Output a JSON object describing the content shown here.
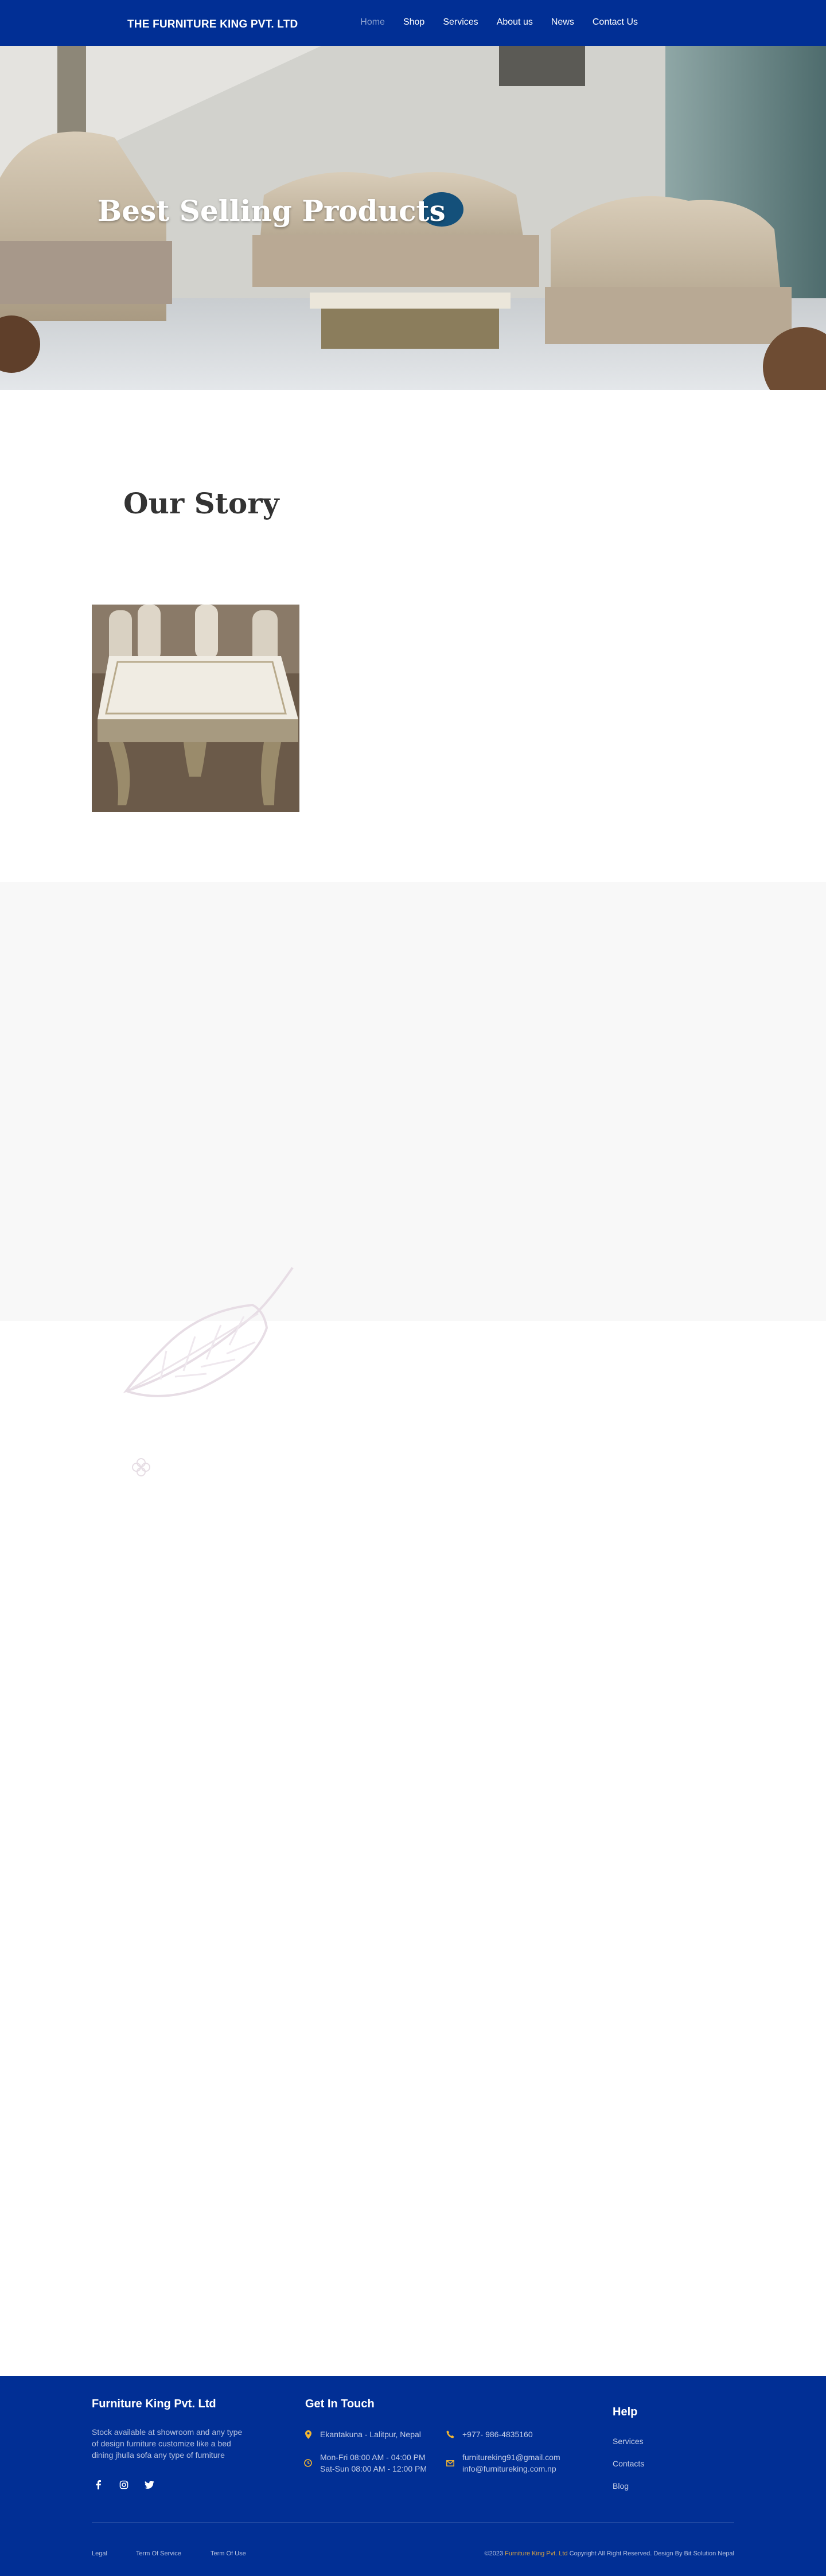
{
  "header": {
    "brand": "THE FURNITURE KING PVT. LTD",
    "nav": [
      {
        "label": "Home",
        "active": true
      },
      {
        "label": "Shop"
      },
      {
        "label": "Services"
      },
      {
        "label": "About us"
      },
      {
        "label": "News"
      },
      {
        "label": "Contact Us"
      }
    ]
  },
  "hero": {
    "title": "Best Selling Products"
  },
  "story": {
    "title": "Our Story"
  },
  "footer": {
    "company": {
      "title": "Furniture King Pvt. Ltd",
      "description": "Stock available at showroom and any type of design furniture customize like a bed dining jhulla sofa any type of furniture"
    },
    "social": [
      "facebook-icon",
      "instagram-icon",
      "twitter-icon"
    ],
    "contact": {
      "title": "Get In Touch",
      "address": "Ekantakuna - Lalitpur, Nepal",
      "phone": "+977- 986-4835160",
      "hours_weekday": "Mon-Fri 08:00 AM - 04:00 PM",
      "hours_weekend": "Sat-Sun 08:00 AM - 12:00 PM",
      "email_1": "furnitureking91@gmail.com",
      "email_2": "info@furnitureking.com.np"
    },
    "help": {
      "title": "Help",
      "links": [
        "Services",
        "Contacts",
        "Blog"
      ]
    },
    "bottom_links": [
      "Legal",
      "Term Of Service",
      "Term Of Use"
    ],
    "copyright_prefix": "©2023 ",
    "copyright_company": "Furniture King Pvt. Ltd",
    "copyright_suffix": " Copyright All Right Reserved. Design By Bit Solution Nepal"
  },
  "colors": {
    "primary": "#012f95",
    "accent": "#d9a441",
    "grey_block": "#f8f8f8"
  }
}
